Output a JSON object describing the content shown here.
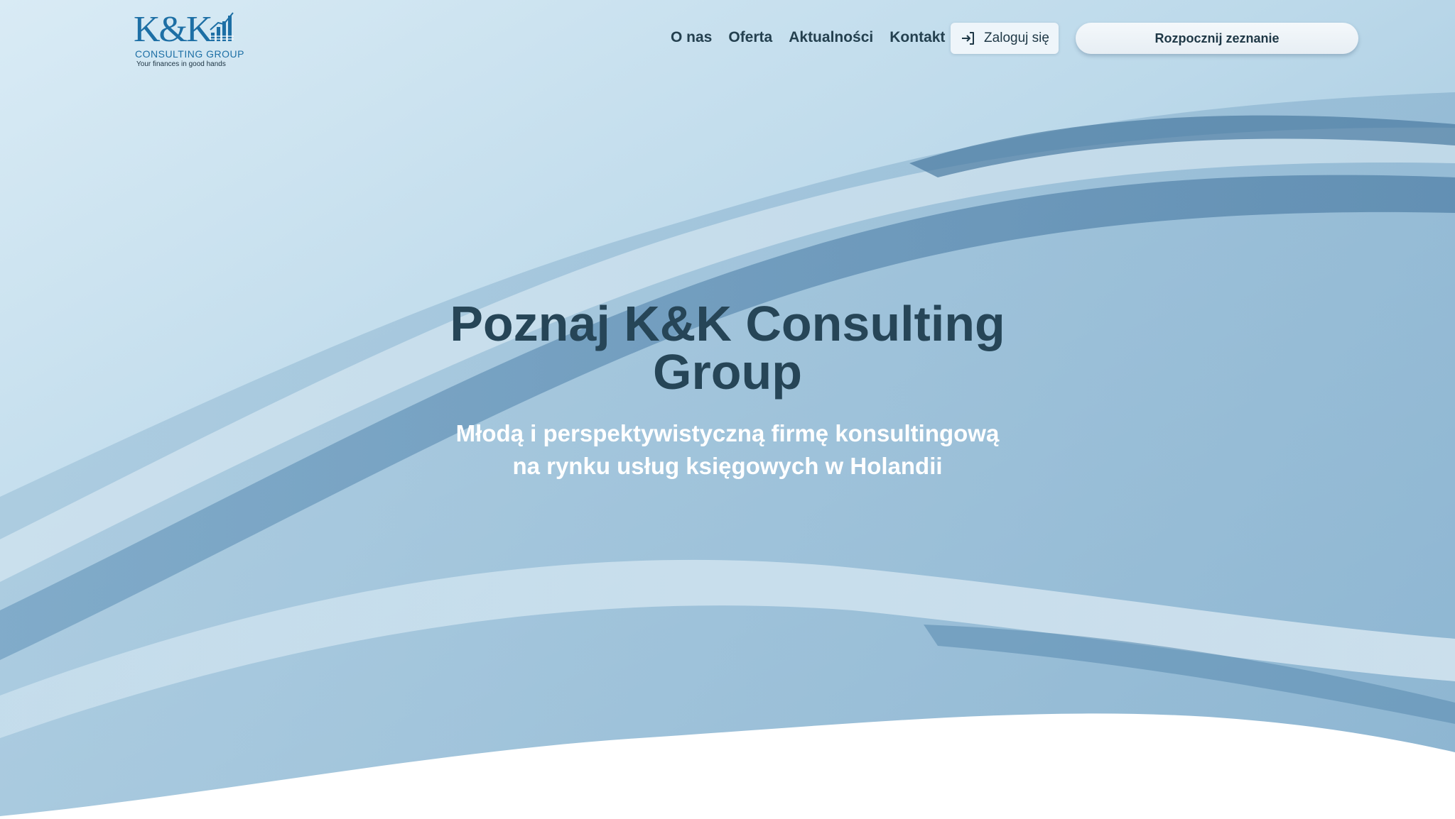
{
  "brand": {
    "logo_mark": "K&K",
    "logo_subtitle": "CONSULTING GROUP",
    "logo_tagline": "Your finances in good hands",
    "primary_color": "#1d6fa5"
  },
  "nav": {
    "items": [
      {
        "label": "O nas"
      },
      {
        "label": "Oferta"
      },
      {
        "label": "Aktualności"
      },
      {
        "label": "Kontakt"
      }
    ],
    "login_label": "Zaloguj się",
    "login_icon": "login-arrow-icon",
    "cta_label": "Rozpocznij zeznanie"
  },
  "hero": {
    "title": "Poznaj K&K Consulting Group",
    "subtitle": "Młodą i perspektywistyczną firmę konsultingową na rynku usług księgowych w Holandii",
    "title_color": "#264557",
    "subtitle_color": "#ffffff",
    "background_colors": [
      "#dcecf5",
      "#9dc2d9",
      "#6f9bbd",
      "#ffffff"
    ]
  }
}
